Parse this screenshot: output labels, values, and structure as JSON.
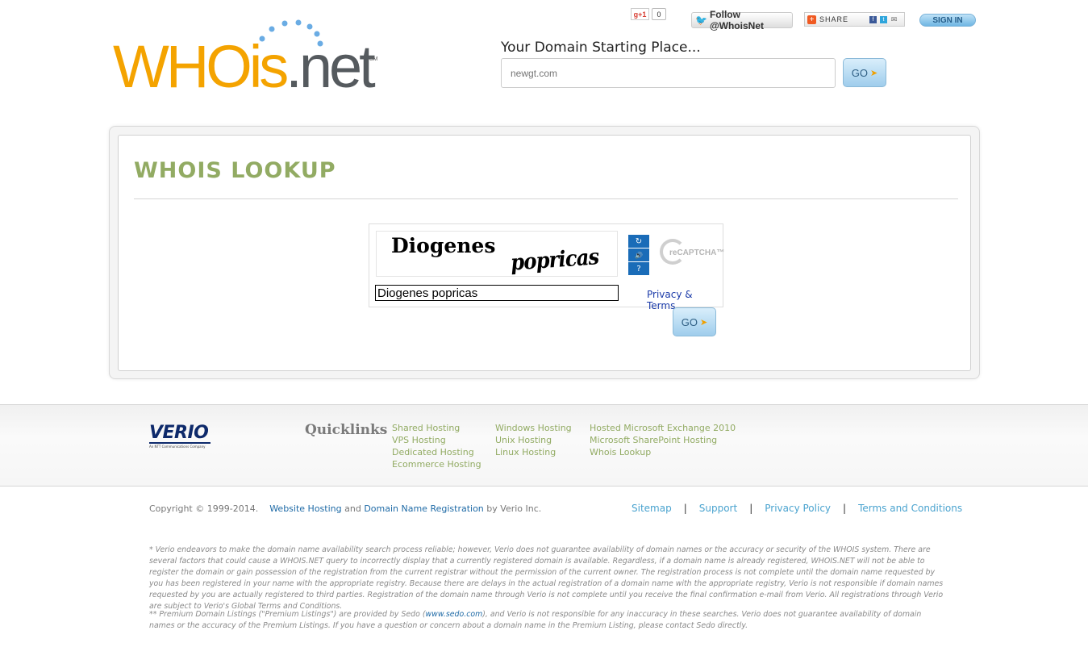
{
  "header": {
    "logo_text_main": "WHOis",
    "logo_text_suffix": ".net",
    "logo_mark": "SM",
    "gplus_label": "g+1",
    "gplus_count": "0",
    "follow_label": "Follow @WhoisNet",
    "share_label": "SHARE",
    "signin_label": "SIGN IN",
    "tagline": "Your Domain Starting Place...",
    "domain_input_placeholder": "newgt.com",
    "go_label": "GO"
  },
  "main": {
    "title": "WHOIS LOOKUP",
    "captcha": {
      "word1": "Diogenes",
      "word2": "popricas",
      "response_value": "Diogenes popricas",
      "reload_glyph": "↻",
      "audio_glyph": "🔊",
      "help_glyph": "?",
      "brand": "reCAPTCHA™",
      "privacy_terms": "Privacy & Terms"
    },
    "go_label": "GO"
  },
  "footer": {
    "verio_logo": "VERIO",
    "verio_sub": "An NTT Communications Company",
    "quicklinks_title": "Quicklinks",
    "col1": [
      "Shared Hosting",
      "VPS Hosting",
      "Dedicated Hosting",
      "Ecommerce Hosting"
    ],
    "col2": [
      "Windows Hosting",
      "Unix Hosting",
      "Linux Hosting"
    ],
    "col3": [
      "Hosted Microsoft Exchange 2010",
      "Microsoft SharePoint Hosting",
      "Whois Lookup"
    ],
    "copyright_prefix": "Copyright © 1999-2014.",
    "copyright_link1": "Website Hosting",
    "copyright_and": "and",
    "copyright_link2": "Domain Name Registration",
    "copyright_suffix": "by Verio Inc.",
    "links": [
      "Sitemap",
      "Support",
      "Privacy Policy",
      "Terms and Conditions"
    ],
    "separator": "|",
    "disclaimer1": "* Verio endeavors to make the domain name availability search process reliable; however, Verio does not guarantee availability of domain names or the accuracy or security of the WHOIS system. There are several factors that could cause a WHOIS.NET query to incorrectly display that a currently registered domain is available. Regardless, if a domain name is already registered, WHOIS.NET will not be able to register the domain or gain possession of the registration from the current registrar without the permission of the current owner. The registration process is not complete until the domain name requested by you has been registered in your name with the appropriate registry. Because there are delays in the actual registration of a domain name with the appropriate registry, Verio is not responsible if domain names requested by you are actually registered to third parties. Registration of the domain name through Verio is not complete until you receive the final confirmation e-mail from Verio. All registrations through Verio are subject to Verio's Global Terms and Conditions.",
    "disclaimer2_prefix": "** Premium Domain Listings (\"Premium Listings\") are provided by Sedo (",
    "disclaimer2_link": "www.sedo.com",
    "disclaimer2_suffix": "), and Verio is not responsible for any inaccuracy in these searches. Verio does not guarantee availability of domain names or the accuracy of the Premium Listings. If you have a question or concern about a domain name in the Premium Listing, please contact Sedo directly."
  },
  "colors": {
    "logo_orange": "#f4a300",
    "logo_gray": "#555a5e",
    "title_green": "#92ab63",
    "link_blue": "#4aa3cf",
    "recaptcha_blue": "#1a6cb8"
  }
}
